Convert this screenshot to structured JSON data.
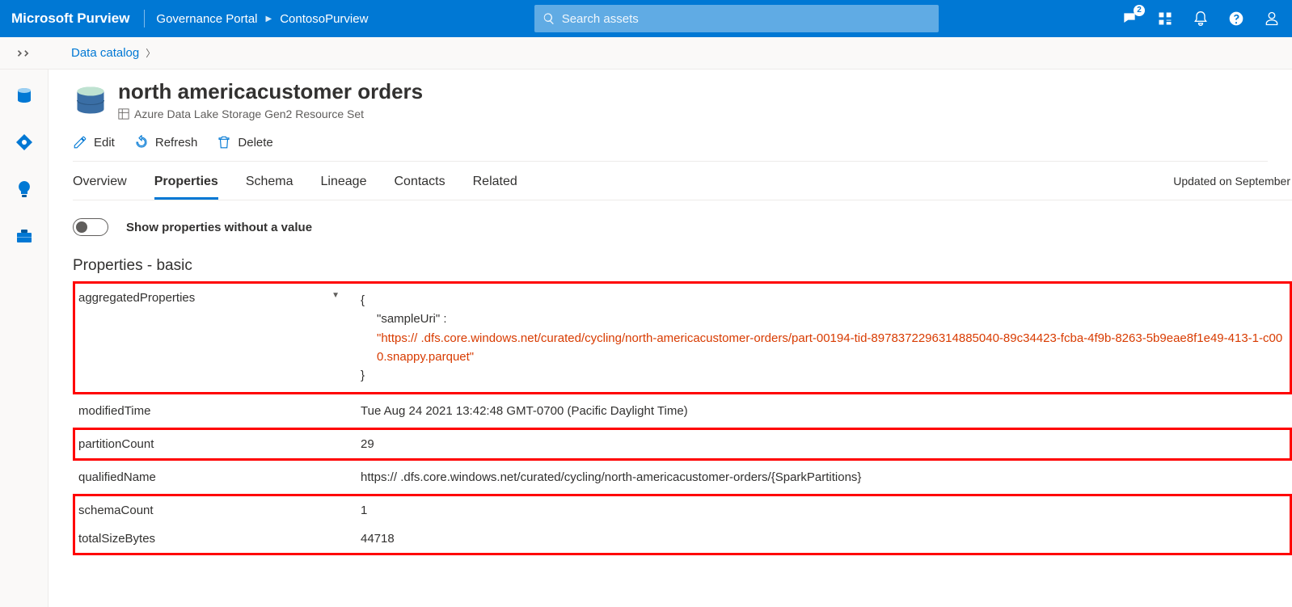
{
  "header": {
    "brand": "Microsoft Purview",
    "portal": "Governance Portal",
    "instance": "ContosoPurview",
    "search_placeholder": "Search assets",
    "notif_count": "2"
  },
  "breadcrumb": {
    "items": [
      "Data catalog"
    ]
  },
  "asset": {
    "title": "north americacustomer orders",
    "subtype": "Azure Data Lake Storage Gen2 Resource Set"
  },
  "toolbar": {
    "edit": "Edit",
    "refresh": "Refresh",
    "delete": "Delete"
  },
  "tabs": {
    "items": [
      "Overview",
      "Properties",
      "Schema",
      "Lineage",
      "Contacts",
      "Related"
    ],
    "updated": "Updated on September"
  },
  "toggle": {
    "label": "Show properties without a value"
  },
  "section": {
    "title": "Properties - basic"
  },
  "props": {
    "aggregatedProperties": {
      "label": "aggregatedProperties",
      "json_key": "\"sampleUri\" :",
      "json_val": "\"https://                           .dfs.core.windows.net/curated/cycling/north-americacustomer-orders/part-00194-tid-8978372296314885040-89c34423-fcba-4f9b-8263-5b9eae8f1e49-413-1-c000.snappy.parquet\""
    },
    "modifiedTime": {
      "label": "modifiedTime",
      "value": "Tue Aug 24 2021 13:42:48 GMT-0700 (Pacific Daylight Time)"
    },
    "partitionCount": {
      "label": "partitionCount",
      "value": "29"
    },
    "qualifiedName": {
      "label": "qualifiedName",
      "value": "https://                              .dfs.core.windows.net/curated/cycling/north-americacustomer-orders/{SparkPartitions}"
    },
    "schemaCount": {
      "label": "schemaCount",
      "value": "1"
    },
    "totalSizeBytes": {
      "label": "totalSizeBytes",
      "value": "44718"
    }
  }
}
